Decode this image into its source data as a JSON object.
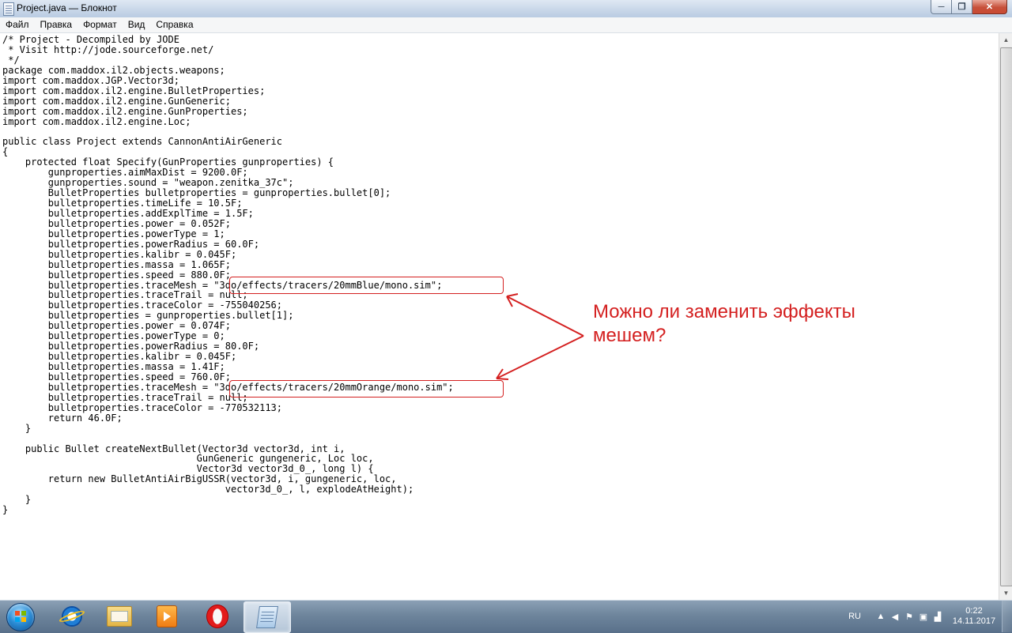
{
  "window": {
    "title": "Project.java — Блокнот",
    "buttons": {
      "minimize": "─",
      "maximize": "❐",
      "close": "✕"
    }
  },
  "menu": [
    "Файл",
    "Правка",
    "Формат",
    "Вид",
    "Справка"
  ],
  "editor": {
    "lines": [
      "/* Project - Decompiled by JODE",
      " * Visit http://jode.sourceforge.net/",
      " */",
      "package com.maddox.il2.objects.weapons;",
      "import com.maddox.JGP.Vector3d;",
      "import com.maddox.il2.engine.BulletProperties;",
      "import com.maddox.il2.engine.GunGeneric;",
      "import com.maddox.il2.engine.GunProperties;",
      "import com.maddox.il2.engine.Loc;",
      "",
      "public class Project extends CannonAntiAirGeneric",
      "{",
      "    protected float Specify(GunProperties gunproperties) {",
      "        gunproperties.aimMaxDist = 9200.0F;",
      "        gunproperties.sound = \"weapon.zenitka_37c\";",
      "        BulletProperties bulletproperties = gunproperties.bullet[0];",
      "        bulletproperties.timeLife = 10.5F;",
      "        bulletproperties.addExplTime = 1.5F;",
      "        bulletproperties.power = 0.052F;",
      "        bulletproperties.powerType = 1;",
      "        bulletproperties.powerRadius = 60.0F;",
      "        bulletproperties.kalibr = 0.045F;",
      "        bulletproperties.massa = 1.065F;",
      "        bulletproperties.speed = 880.0F;",
      "        bulletproperties.traceMesh = \"3do/effects/tracers/20mmBlue/mono.sim\";",
      "        bulletproperties.traceTrail = null;",
      "        bulletproperties.traceColor = -755040256;",
      "        bulletproperties = gunproperties.bullet[1];",
      "        bulletproperties.power = 0.074F;",
      "        bulletproperties.powerType = 0;",
      "        bulletproperties.powerRadius = 80.0F;",
      "        bulletproperties.kalibr = 0.045F;",
      "        bulletproperties.massa = 1.41F;",
      "        bulletproperties.speed = 760.0F;",
      "        bulletproperties.traceMesh = \"3do/effects/tracers/20mmOrange/mono.sim\";",
      "        bulletproperties.traceTrail = null;",
      "        bulletproperties.traceColor = -770532113;",
      "        return 46.0F;",
      "    }",
      "",
      "    public Bullet createNextBullet(Vector3d vector3d, int i,",
      "                                  GunGeneric gungeneric, Loc loc,",
      "                                  Vector3d vector3d_0_, long l) {",
      "        return new BulletAntiAirBigUSSR(vector3d, i, gungeneric, loc,",
      "                                       vector3d_0_, l, explodeAtHeight);",
      "    }",
      "}"
    ]
  },
  "annotation": {
    "text": "Можно ли заменить эффекты мешем?",
    "color": "#d42020"
  },
  "taskbar": {
    "apps": [
      {
        "name": "Internet Explorer",
        "icon": "ie-icon",
        "active": false
      },
      {
        "name": "Windows Explorer",
        "icon": "folder-icon",
        "active": false
      },
      {
        "name": "Windows Media Player",
        "icon": "media-player-icon",
        "active": false
      },
      {
        "name": "Opera",
        "icon": "opera-icon",
        "active": false
      },
      {
        "name": "Notepad",
        "icon": "notepad-icon",
        "active": true
      }
    ],
    "tray": {
      "language": "RU",
      "clock_time": "0:22",
      "clock_date": "14.11.2017"
    }
  }
}
